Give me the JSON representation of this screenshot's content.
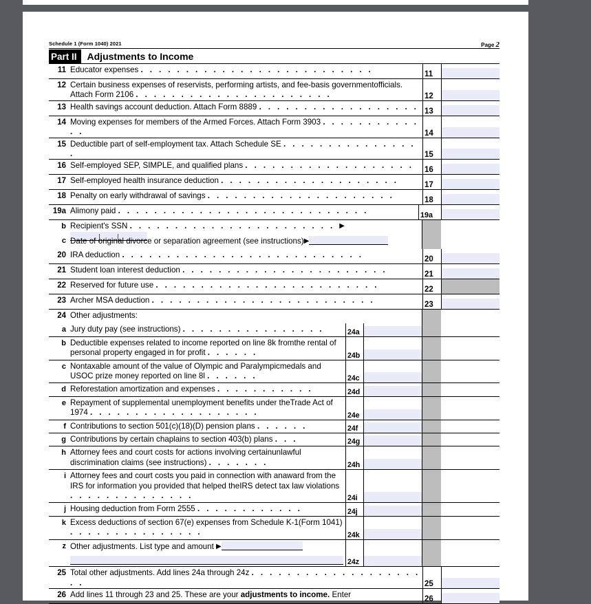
{
  "document": {
    "form_id": "Schedule 1 (Form 1040) 2021",
    "page_label": "Page",
    "page_number": "2",
    "part_number": "Part II",
    "part_title": "Adjustments to Income"
  },
  "colors": {
    "viewer_background": "#565a5e",
    "page_background": "#ffffff",
    "entry_fill": "#e9ecf8",
    "shaded_cell": "#bdbdbd",
    "rule": "#000000"
  },
  "lines": [
    {
      "no": "11",
      "text": "Educator expenses",
      "box": "11",
      "fill": "entry"
    },
    {
      "no": "12",
      "text": "Certain business expenses of reservists, performing artists, and fee-basis government officials. Attach Form 2106",
      "line1": "Certain business expenses of reservists, performing artists, and fee-basis government",
      "line2": "officials. Attach Form 2106",
      "box": "12",
      "fill": "entry"
    },
    {
      "no": "13",
      "text": "Health savings account deduction. Attach Form 8889",
      "box": "13",
      "fill": "entry"
    },
    {
      "no": "14",
      "text": "Moving expenses for members of the Armed Forces. Attach Form 3903",
      "box": "14",
      "fill": "entry"
    },
    {
      "no": "15",
      "text": "Deductible part of self-employment tax. Attach Schedule SE",
      "box": "15",
      "fill": "entry"
    },
    {
      "no": "16",
      "text": "Self-employed SEP, SIMPLE, and qualified plans",
      "box": "16",
      "fill": "entry"
    },
    {
      "no": "17",
      "text": "Self-employed health insurance deduction",
      "box": "17",
      "fill": "entry"
    },
    {
      "no": "18",
      "text": "Penalty on early withdrawal of savings",
      "box": "18",
      "fill": "entry"
    },
    {
      "no": "19a",
      "text": "Alimony paid",
      "box": "19a",
      "fill": "entry"
    },
    {
      "no": "b",
      "text": "Recipient's SSN",
      "box": "",
      "fill": "none"
    },
    {
      "no": "c",
      "text": "Date of original divorce or separation agreement (see instructions)",
      "box": "",
      "fill": "none"
    },
    {
      "no": "20",
      "text": "IRA deduction",
      "box": "20",
      "fill": "entry"
    },
    {
      "no": "21",
      "text": "Student loan interest deduction",
      "box": "21",
      "fill": "entry"
    },
    {
      "no": "22",
      "text": "Reserved for future use",
      "box": "22",
      "fill": "gray"
    },
    {
      "no": "23",
      "text": "Archer MSA deduction",
      "box": "23",
      "fill": "entry"
    },
    {
      "no": "24",
      "text": "Other adjustments:",
      "box": "",
      "fill": "none"
    }
  ],
  "other_adjustments": [
    {
      "letter": "a",
      "tag": "24a",
      "lines": [
        "Jury duty pay (see instructions)"
      ],
      "justify": false
    },
    {
      "letter": "b",
      "tag": "24b",
      "lines": [
        "Deductible expenses related to income reported on line 8k from",
        "the rental of personal property engaged in for profit"
      ],
      "justify": false
    },
    {
      "letter": "c",
      "tag": "24c",
      "lines": [
        "Nontaxable amount of the value of Olympic and Paralympic",
        "medals and USOC prize money reported on line 8l"
      ],
      "justify": true
    },
    {
      "letter": "d",
      "tag": "24d",
      "lines": [
        "Reforestation amortization and expenses"
      ],
      "justify": false
    },
    {
      "letter": "e",
      "tag": "24e",
      "lines": [
        "Repayment of supplemental unemployment benefits under the",
        "Trade Act of 1974"
      ],
      "justify": true
    },
    {
      "letter": "f",
      "tag": "24f",
      "lines": [
        "Contributions to section 501(c)(18)(D) pension plans"
      ],
      "justify": false
    },
    {
      "letter": "g",
      "tag": "24g",
      "lines": [
        "Contributions by certain chaplains to section 403(b) plans"
      ],
      "justify": false
    },
    {
      "letter": "h",
      "tag": "24h",
      "lines": [
        "Attorney fees and court costs for actions involving certain",
        "unlawful discrimination claims (see instructions)"
      ],
      "justify": true
    },
    {
      "letter": "i",
      "tag": "24i",
      "lines": [
        "Attorney fees and court costs you paid in connection with an",
        "award from the IRS for information you provided that helped the",
        "IRS detect tax law violations"
      ],
      "justify": true
    },
    {
      "letter": "j",
      "tag": "24j",
      "lines": [
        "Housing deduction from Form 2555"
      ],
      "justify": false
    },
    {
      "letter": "k",
      "tag": "24k",
      "lines": [
        "Excess deductions of section 67(e) expenses from Schedule K-1",
        "(Form 1041)"
      ],
      "justify": false
    },
    {
      "letter": "z",
      "tag": "24z",
      "lines": [
        "Other adjustments. List type and amount"
      ],
      "justify": false
    }
  ],
  "totals": [
    {
      "no": "25",
      "text": "Total other adjustments. Add lines 24a through 24z",
      "box": "25",
      "fill": "entry"
    },
    {
      "no": "26",
      "text": "Add lines 11 through 23 and 25. These are your adjustments to income. Enter",
      "bold_part": "adjustments to income.",
      "box": "26",
      "fill": "entry"
    }
  ],
  "icons": {
    "arrow": "▶"
  }
}
